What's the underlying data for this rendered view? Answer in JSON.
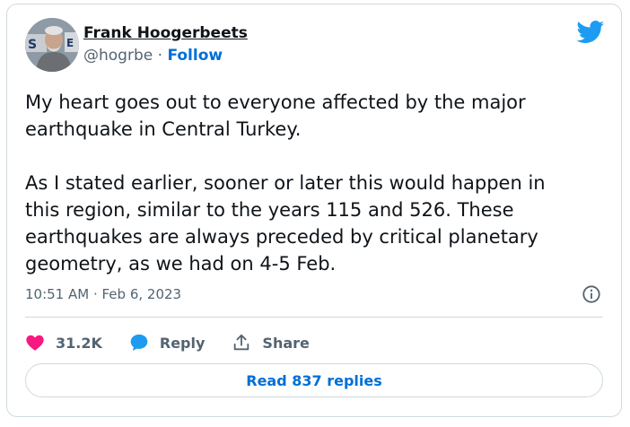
{
  "author": {
    "name": "Frank Hoogerbeets",
    "handle": "@hogrbe",
    "separator": " · ",
    "follow_label": "Follow",
    "avatar_icon": "profile-photo"
  },
  "tweet": {
    "text": "My heart goes out to everyone affected by the major earthquake in Central Turkey.\n\nAs I stated earlier, sooner or later this would happen in this region, similar to the years 115 and 526. These earthquakes are always preceded by critical planetary geometry, as we had on 4-5 Feb.",
    "timestamp": "10:51 AM · Feb 6, 2023"
  },
  "actions": {
    "likes": "31.2K",
    "reply_label": "Reply",
    "share_label": "Share"
  },
  "read_replies_label": "Read 837 replies",
  "colors": {
    "brand": "#1d9bf0",
    "link": "#006fd6",
    "heart": "#f91880",
    "border": "#cfd9de",
    "text": "#0f1419",
    "muted": "#536471"
  }
}
